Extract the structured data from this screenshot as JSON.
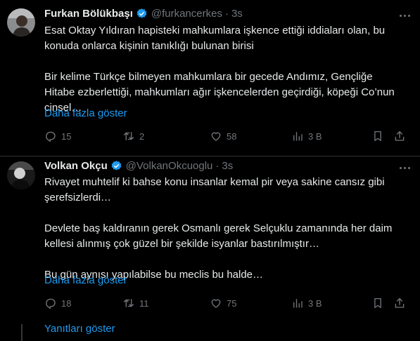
{
  "tweets": [
    {
      "name": "Furkan Bölükbaşı",
      "handle": "@furkancerkes",
      "time": "3s",
      "paragraphs": [
        "Esat Oktay Yıldıran hapisteki mahkumlara işkence ettiği iddiaları olan, bu konuda onlarca kişinin tanıklığı bulunan birisi",
        "Bir kelime Türkçe bilmeyen mahkumlara bir gecede Andımız, Gençliğe Hitabe ezberlettiği, mahkumları ağır işkencelerden geçirdiği, köpeği Co’nun cinsel…"
      ],
      "show_more": "Daha fazla göster",
      "stats": {
        "replies": "15",
        "retweets": "2",
        "likes": "58",
        "views": "3 B"
      }
    },
    {
      "name": "Volkan Okçu",
      "handle": "@VolkanOkcuoglu",
      "time": "3s",
      "paragraphs": [
        "Rivayet muhtelif ki bahse konu insanlar kemal pir veya sakine cansız gibi şerefsizlerdi…",
        "Devlete baş kaldıranın gerek Osmanlı gerek Selçuklu zamanında her daim kellesi alınmış çok güzel bir şekilde isyanlar bastırılmıştır…",
        "Bu gün aynısı yapılabilse bu meclis bu halde…"
      ],
      "show_more": "Daha fazla göster",
      "stats": {
        "replies": "18",
        "retweets": "11",
        "likes": "75",
        "views": "3 B"
      }
    }
  ],
  "show_replies": "Yanıtları göster",
  "colors": {
    "background": "#000000",
    "text": "#e7e9ea",
    "muted": "#71767b",
    "accent": "#1d9bf0"
  },
  "icons": [
    "verified-badge-icon",
    "more-icon",
    "reply-icon",
    "retweet-icon",
    "like-icon",
    "views-icon",
    "bookmark-icon",
    "share-icon"
  ]
}
